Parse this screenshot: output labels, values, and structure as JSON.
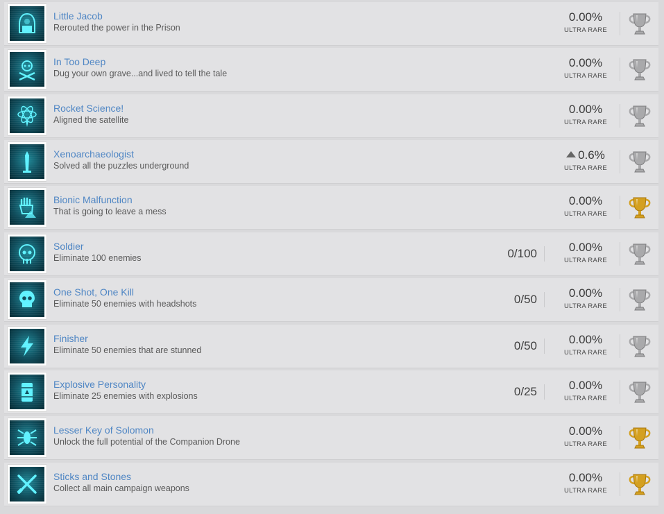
{
  "achievements": [
    {
      "title": "Little Jacob",
      "description": "Rerouted the power in the Prison",
      "progress": "",
      "percent": "0.00%",
      "rarity": "ULTRA RARE",
      "trophy": "silver",
      "icon": "hooded-hacker-icon"
    },
    {
      "title": "In Too Deep",
      "description": "Dug your own grave...and lived to tell the tale",
      "progress": "",
      "percent": "0.00%",
      "rarity": "ULTRA RARE",
      "trophy": "silver",
      "icon": "skull-crossbones-icon"
    },
    {
      "title": "Rocket Science!",
      "description": "Aligned the satellite",
      "progress": "",
      "percent": "0.00%",
      "rarity": "ULTRA RARE",
      "trophy": "silver",
      "icon": "atom-rocket-icon"
    },
    {
      "title": "Xenoarchaeologist",
      "description": "Solved all the puzzles underground",
      "progress": "",
      "percent": "0.6%",
      "rarity": "ULTRA RARE",
      "trophy": "silver",
      "icon": "obelisk-icon",
      "rank_arrow": true
    },
    {
      "title": "Bionic Malfunction",
      "description": "That is going to leave a mess",
      "progress": "",
      "percent": "0.00%",
      "rarity": "ULTRA RARE",
      "trophy": "gold",
      "icon": "robotic-hand-icon"
    },
    {
      "title": "Soldier",
      "description": "Eliminate 100 enemies",
      "progress": "0/100",
      "percent": "0.00%",
      "rarity": "ULTRA RARE",
      "trophy": "silver",
      "icon": "soldier-skull-icon"
    },
    {
      "title": "One Shot, One Kill",
      "description": "Eliminate 50 enemies with headshots",
      "progress": "0/50",
      "percent": "0.00%",
      "rarity": "ULTRA RARE",
      "trophy": "silver",
      "icon": "skull-icon"
    },
    {
      "title": "Finisher",
      "description": "Eliminate 50 enemies that are stunned",
      "progress": "0/50",
      "percent": "0.00%",
      "rarity": "ULTRA RARE",
      "trophy": "silver",
      "icon": "lightning-icon"
    },
    {
      "title": "Explosive Personality",
      "description": "Eliminate 25 enemies with explosions",
      "progress": "0/25",
      "percent": "0.00%",
      "rarity": "ULTRA RARE",
      "trophy": "silver",
      "icon": "explosive-barrel-icon"
    },
    {
      "title": "Lesser Key of Solomon",
      "description": "Unlock the full potential of the Companion Drone",
      "progress": "",
      "percent": "0.00%",
      "rarity": "ULTRA RARE",
      "trophy": "gold",
      "icon": "drone-icon"
    },
    {
      "title": "Sticks and Stones",
      "description": "Collect all main campaign weapons",
      "progress": "",
      "percent": "0.00%",
      "rarity": "ULTRA RARE",
      "trophy": "gold",
      "icon": "crossed-weapons-icon"
    }
  ],
  "colors": {
    "title": "#4f86c4",
    "silver": "#a9a9ab",
    "gold": "#d4a020",
    "icon_glow": "#5ff2ff"
  }
}
